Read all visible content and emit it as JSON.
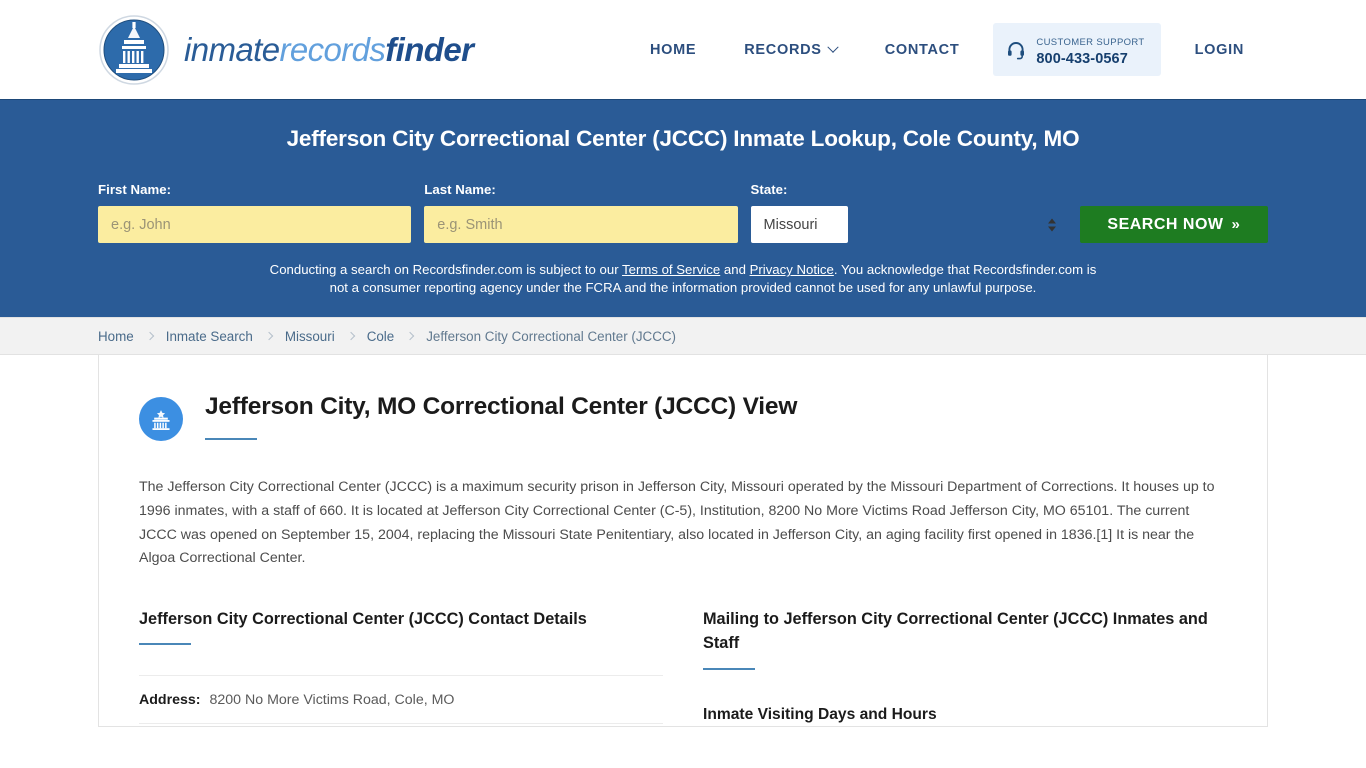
{
  "brand": {
    "part1": "inmate",
    "part2": "records",
    "part3": "finder",
    "logo_icon": "capitol-dome-icon"
  },
  "nav": {
    "items": [
      {
        "label": "HOME",
        "has_caret": false
      },
      {
        "label": "RECORDS",
        "has_caret": true
      },
      {
        "label": "CONTACT",
        "has_caret": false
      }
    ],
    "login_label": "LOGIN",
    "support": {
      "icon": "headset-icon",
      "label": "CUSTOMER SUPPORT",
      "phone": "800-433-0567",
      "bg_color": "#eaf2fb"
    }
  },
  "hero": {
    "title": "Jefferson City Correctional Center (JCCC) Inmate Lookup, Cole County, MO",
    "bg_color": "#2a5b96",
    "first_name": {
      "label": "First Name:",
      "placeholder": "e.g. John",
      "value": ""
    },
    "last_name": {
      "label": "Last Name:",
      "placeholder": "e.g. Smith",
      "value": ""
    },
    "state": {
      "label": "State:",
      "selected": "Missouri",
      "options": [
        "Missouri"
      ]
    },
    "search_button": {
      "label": "SEARCH NOW",
      "chevron": "»",
      "color": "#1e7c21"
    },
    "disclaimer": {
      "part1": "Conducting a search on Recordsfinder.com is subject to our ",
      "link1": "Terms of Service",
      "part2": " and ",
      "link2": "Privacy Notice",
      "part3": ". You acknowledge that Recordsfinder.com is not a consumer reporting agency under the FCRA and the information provided cannot be used for any unlawful purpose."
    }
  },
  "breadcrumb": {
    "items": [
      {
        "label": "Home"
      },
      {
        "label": "Inmate Search"
      },
      {
        "label": "Missouri"
      },
      {
        "label": "Cole"
      }
    ],
    "current": "Jefferson City Correctional Center (JCCC)"
  },
  "main": {
    "icon": "prison-building-icon",
    "title": "Jefferson City, MO Correctional Center (JCCC) View",
    "accent_color": "#4a87b8",
    "intro": "The Jefferson City Correctional Center (JCCC) is a maximum security prison in Jefferson City, Missouri operated by the Missouri Department of Corrections. It houses up to 1996 inmates, with a staff of 660. It is located at Jefferson City Correctional Center (C-5), Institution, 8200 No More Victims Road Jefferson City, MO 65101. The current JCCC was opened on September 15, 2004, replacing the Missouri State Penitentiary, also located in Jefferson City, an aging facility first opened in 1836.[1] It is near the Algoa Correctional Center.",
    "left_column": {
      "heading": "Jefferson City Correctional Center (JCCC) Contact Details",
      "rows": [
        {
          "key": "Address:",
          "value": "8200 No More Victims Road, Cole, MO"
        }
      ]
    },
    "right_column": {
      "heading": "Mailing to Jefferson City Correctional Center (JCCC) Inmates and Staff",
      "subheading": "Inmate Visiting Days and Hours"
    }
  }
}
